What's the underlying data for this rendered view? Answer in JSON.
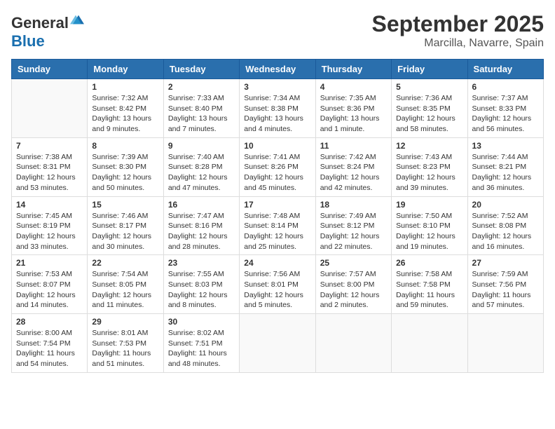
{
  "header": {
    "logo_general": "General",
    "logo_blue": "Blue",
    "month": "September 2025",
    "location": "Marcilla, Navarre, Spain"
  },
  "days_of_week": [
    "Sunday",
    "Monday",
    "Tuesday",
    "Wednesday",
    "Thursday",
    "Friday",
    "Saturday"
  ],
  "weeks": [
    [
      {
        "day": "",
        "info": ""
      },
      {
        "day": "1",
        "info": "Sunrise: 7:32 AM\nSunset: 8:42 PM\nDaylight: 13 hours\nand 9 minutes."
      },
      {
        "day": "2",
        "info": "Sunrise: 7:33 AM\nSunset: 8:40 PM\nDaylight: 13 hours\nand 7 minutes."
      },
      {
        "day": "3",
        "info": "Sunrise: 7:34 AM\nSunset: 8:38 PM\nDaylight: 13 hours\nand 4 minutes."
      },
      {
        "day": "4",
        "info": "Sunrise: 7:35 AM\nSunset: 8:36 PM\nDaylight: 13 hours\nand 1 minute."
      },
      {
        "day": "5",
        "info": "Sunrise: 7:36 AM\nSunset: 8:35 PM\nDaylight: 12 hours\nand 58 minutes."
      },
      {
        "day": "6",
        "info": "Sunrise: 7:37 AM\nSunset: 8:33 PM\nDaylight: 12 hours\nand 56 minutes."
      }
    ],
    [
      {
        "day": "7",
        "info": "Sunrise: 7:38 AM\nSunset: 8:31 PM\nDaylight: 12 hours\nand 53 minutes."
      },
      {
        "day": "8",
        "info": "Sunrise: 7:39 AM\nSunset: 8:30 PM\nDaylight: 12 hours\nand 50 minutes."
      },
      {
        "day": "9",
        "info": "Sunrise: 7:40 AM\nSunset: 8:28 PM\nDaylight: 12 hours\nand 47 minutes."
      },
      {
        "day": "10",
        "info": "Sunrise: 7:41 AM\nSunset: 8:26 PM\nDaylight: 12 hours\nand 45 minutes."
      },
      {
        "day": "11",
        "info": "Sunrise: 7:42 AM\nSunset: 8:24 PM\nDaylight: 12 hours\nand 42 minutes."
      },
      {
        "day": "12",
        "info": "Sunrise: 7:43 AM\nSunset: 8:23 PM\nDaylight: 12 hours\nand 39 minutes."
      },
      {
        "day": "13",
        "info": "Sunrise: 7:44 AM\nSunset: 8:21 PM\nDaylight: 12 hours\nand 36 minutes."
      }
    ],
    [
      {
        "day": "14",
        "info": "Sunrise: 7:45 AM\nSunset: 8:19 PM\nDaylight: 12 hours\nand 33 minutes."
      },
      {
        "day": "15",
        "info": "Sunrise: 7:46 AM\nSunset: 8:17 PM\nDaylight: 12 hours\nand 30 minutes."
      },
      {
        "day": "16",
        "info": "Sunrise: 7:47 AM\nSunset: 8:16 PM\nDaylight: 12 hours\nand 28 minutes."
      },
      {
        "day": "17",
        "info": "Sunrise: 7:48 AM\nSunset: 8:14 PM\nDaylight: 12 hours\nand 25 minutes."
      },
      {
        "day": "18",
        "info": "Sunrise: 7:49 AM\nSunset: 8:12 PM\nDaylight: 12 hours\nand 22 minutes."
      },
      {
        "day": "19",
        "info": "Sunrise: 7:50 AM\nSunset: 8:10 PM\nDaylight: 12 hours\nand 19 minutes."
      },
      {
        "day": "20",
        "info": "Sunrise: 7:52 AM\nSunset: 8:08 PM\nDaylight: 12 hours\nand 16 minutes."
      }
    ],
    [
      {
        "day": "21",
        "info": "Sunrise: 7:53 AM\nSunset: 8:07 PM\nDaylight: 12 hours\nand 14 minutes."
      },
      {
        "day": "22",
        "info": "Sunrise: 7:54 AM\nSunset: 8:05 PM\nDaylight: 12 hours\nand 11 minutes."
      },
      {
        "day": "23",
        "info": "Sunrise: 7:55 AM\nSunset: 8:03 PM\nDaylight: 12 hours\nand 8 minutes."
      },
      {
        "day": "24",
        "info": "Sunrise: 7:56 AM\nSunset: 8:01 PM\nDaylight: 12 hours\nand 5 minutes."
      },
      {
        "day": "25",
        "info": "Sunrise: 7:57 AM\nSunset: 8:00 PM\nDaylight: 12 hours\nand 2 minutes."
      },
      {
        "day": "26",
        "info": "Sunrise: 7:58 AM\nSunset: 7:58 PM\nDaylight: 11 hours\nand 59 minutes."
      },
      {
        "day": "27",
        "info": "Sunrise: 7:59 AM\nSunset: 7:56 PM\nDaylight: 11 hours\nand 57 minutes."
      }
    ],
    [
      {
        "day": "28",
        "info": "Sunrise: 8:00 AM\nSunset: 7:54 PM\nDaylight: 11 hours\nand 54 minutes."
      },
      {
        "day": "29",
        "info": "Sunrise: 8:01 AM\nSunset: 7:53 PM\nDaylight: 11 hours\nand 51 minutes."
      },
      {
        "day": "30",
        "info": "Sunrise: 8:02 AM\nSunset: 7:51 PM\nDaylight: 11 hours\nand 48 minutes."
      },
      {
        "day": "",
        "info": ""
      },
      {
        "day": "",
        "info": ""
      },
      {
        "day": "",
        "info": ""
      },
      {
        "day": "",
        "info": ""
      }
    ]
  ]
}
